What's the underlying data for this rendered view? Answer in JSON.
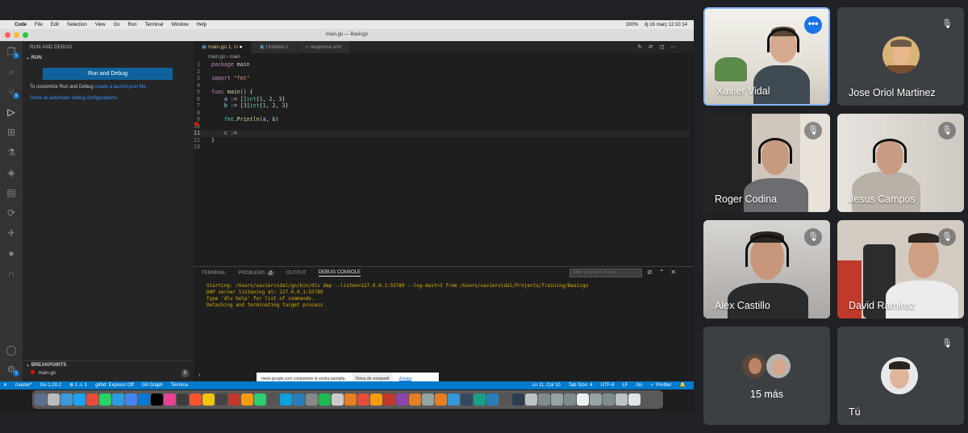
{
  "mac_menubar": {
    "app": "Code",
    "items": [
      "File",
      "Edit",
      "Selection",
      "View",
      "Go",
      "Run",
      "Terminal",
      "Window",
      "Help"
    ],
    "battery": "100%",
    "datetime": "dj 16 març  12:10:14"
  },
  "window": {
    "title": "main.go — Basicgo"
  },
  "activity_bar": {
    "icons": [
      "files-icon",
      "search-icon",
      "source-control-icon",
      "run-debug-icon",
      "extensions-icon",
      "testing-icon",
      "docker-icon",
      "remote-explorer-icon",
      "live-share-icon",
      "deploy-icon",
      "account-icon",
      "settings-icon"
    ],
    "badges": {
      "files": "1",
      "source_control": "9",
      "settings": "1"
    }
  },
  "sidebar": {
    "title": "RUN AND DEBUG",
    "section": "RUN",
    "run_button": "Run and Debug",
    "customize_text": "To customize Run and Debug",
    "customize_link": "create a launch.json file.",
    "show_all_link": "Show all automatic debug configurations.",
    "breakpoints_title": "BREAKPOINTS",
    "breakpoint_file": "main.go",
    "breakpoint_line": "6"
  },
  "tabs": [
    {
      "label": "main.go 1, U",
      "active": true
    },
    {
      "label": "Untitled-1",
      "active": false
    },
    {
      "label": "response.xml",
      "active": false
    }
  ],
  "breadcrumb": {
    "file": "main.go",
    "symbol": "main"
  },
  "code_lines": [
    "package main",
    "",
    "import \"fmt\"",
    "",
    "func main() {",
    "    a := []int{1, 2, 3}",
    "    b := [3]int{1, 2, 3}",
    "",
    "    fmt.Println(a, b)",
    "",
    "    c :=",
    "}",
    ""
  ],
  "panel": {
    "tabs": [
      "TERMINAL",
      "PROBLEMS",
      "OUTPUT",
      "DEBUG CONSOLE"
    ],
    "problems_count": "2",
    "active_tab": "DEBUG CONSOLE",
    "filter_placeholder": "Filter (e.g. text, !exclu...",
    "console_lines": [
      "Starting: /Users/xaviervidal/go/bin/dlv dap --listen=127.0.0.1:55789 --log-dest=3 from /Users/xaviervidal/Projects/Training/Basicgo",
      "DAP server listening at: 127.0.0.1:55789",
      "Type 'dlv help' for list of commands.",
      "Detaching and terminating target process"
    ]
  },
  "statusbar": {
    "branch": "master*",
    "go_version": "Go 1.20.2",
    "problems": "⊗ 1 ⚠ 1",
    "githd": "githd: Express Off",
    "git_graph": "Git Graph",
    "terminal": "Termina",
    "position": "Ln 11, Col 10",
    "tab_size": "Tab Size: 4",
    "encoding": "UTF-8",
    "eol": "LF",
    "language": "Go",
    "prettier": "✓ Prettier"
  },
  "share_bar": {
    "message": "meet.google.com comparteix la vostra pantalla.",
    "stop": "Deixa de compartir",
    "hide": "Amaga"
  },
  "colors": {
    "accent": "#007acc",
    "meet_bg": "#202124",
    "tile_bg": "#3c4043",
    "highlight_border": "#8ab4f8",
    "more_button": "#1a73e8"
  },
  "participants": [
    {
      "name": "Xavier Vidal",
      "muted": false,
      "video": true,
      "highlighted": true
    },
    {
      "name": "Jose Oriol Martinez",
      "muted": true,
      "video": false
    },
    {
      "name": "Roger Codina",
      "muted": true,
      "video": true
    },
    {
      "name": "Jesus Campos",
      "muted": true,
      "video": true
    },
    {
      "name": "Alex Castillo",
      "muted": true,
      "video": true
    },
    {
      "name": "David Ramirez",
      "muted": true,
      "video": true
    },
    {
      "name": "15 más",
      "muted": false,
      "video": false
    },
    {
      "name": "Tú",
      "muted": true,
      "video": false
    }
  ]
}
